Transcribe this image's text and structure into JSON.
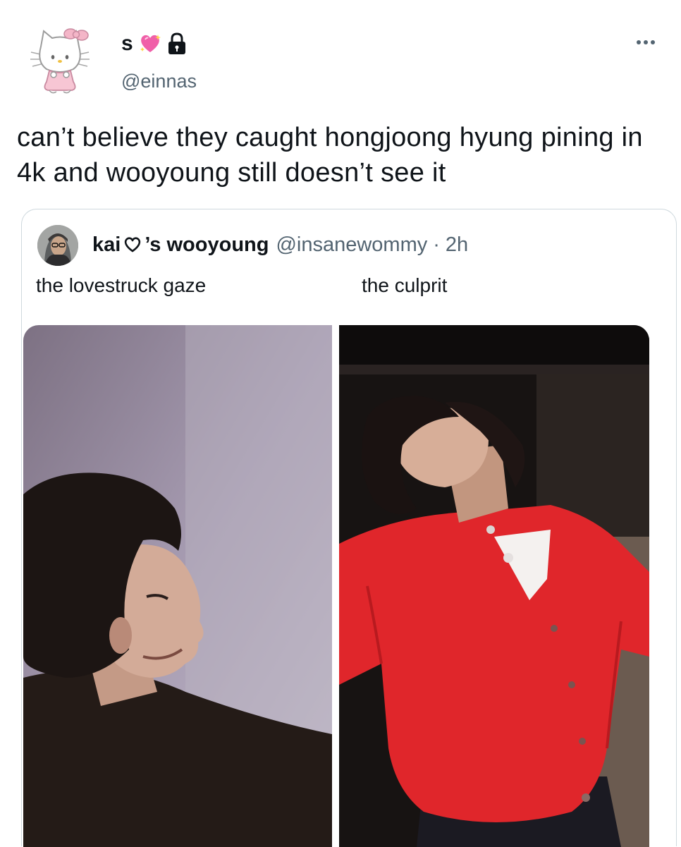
{
  "author": {
    "display_name": "s",
    "handle": "@einnas",
    "name_emoji_icon": "sparkling-heart-icon",
    "protected_icon": "lock-icon",
    "avatar_icon": "hello-kitty-icon"
  },
  "tweet": {
    "text": "can’t believe they caught hongjoong hyung pining in 4k and wooyoung still doesn’t see it"
  },
  "quoted": {
    "name_prefix": "kai ",
    "name_suffix": "’s wooyoung",
    "heart_icon": "heart-outline-icon",
    "handle": "@insanewommy",
    "separator": "·",
    "time": "2h",
    "caption_left": "the lovestruck gaze",
    "caption_right": "the culprit"
  },
  "colors": {
    "text": "#0f1419",
    "secondary": "#536471",
    "border": "#cfd9de",
    "cardigan": "#e0262b"
  }
}
